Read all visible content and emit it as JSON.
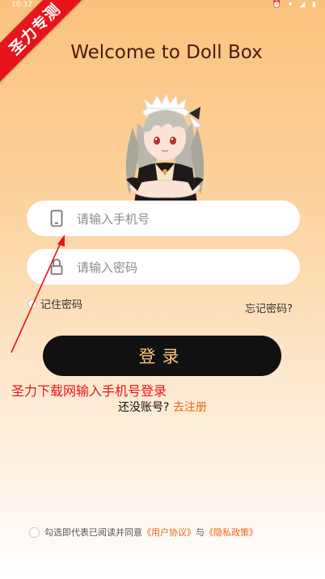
{
  "status_bar": {
    "time": "10:37",
    "icons": "⏰ ▾ ◢ ▮"
  },
  "ribbon": {
    "text": "圣力专测"
  },
  "header": {
    "title": "Welcome to Doll Box"
  },
  "form": {
    "phone_placeholder": "请输入手机号",
    "password_placeholder": "请输入密码",
    "remember_label": "记住密码",
    "forgot_label": "忘记密码?",
    "login_label": "登录"
  },
  "caption": {
    "text": "圣力下载网输入手机号登录"
  },
  "register": {
    "prompt": "还没账号?",
    "link": "去注册"
  },
  "agreement": {
    "prefix": "勾选即代表已阅读并同意",
    "user_agreement": "《用户协议》",
    "and": "与",
    "privacy_policy": "《隐私政策》"
  },
  "colors": {
    "accent": "#ec6412",
    "button_bg": "#111111",
    "button_text": "#fcc37e",
    "watermark": "#e8141b"
  },
  "icons": [
    "phone-icon",
    "lock-icon",
    "mascot-illustration",
    "arrow-annotation"
  ]
}
